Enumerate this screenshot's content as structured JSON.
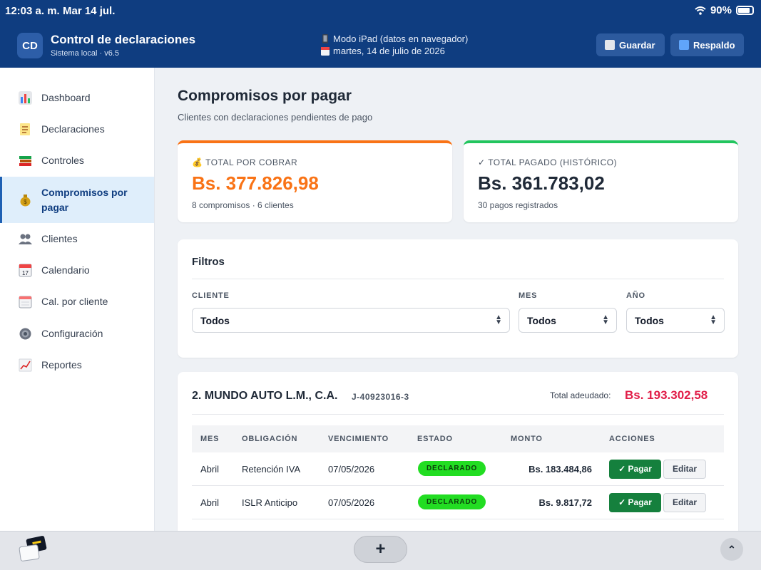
{
  "status_bar": {
    "time": "12:03 a. m.",
    "date": "Mar 14 jul.",
    "battery": "90%",
    "battery_level": 0.9
  },
  "header": {
    "logo": "CD",
    "title": "Control de declaraciones",
    "subtitle": "Sistema local · v6.5",
    "mode_text": "Modo iPad (datos en navegador)",
    "date_text": "martes, 14 de julio de 2026",
    "save_label": "Guardar",
    "backup_label": "Respaldo"
  },
  "sidebar": {
    "items": [
      {
        "label": "Dashboard",
        "icon": "bar-chart-icon"
      },
      {
        "label": "Declaraciones",
        "icon": "memo-icon"
      },
      {
        "label": "Controles",
        "icon": "books-icon"
      },
      {
        "label": "Compromisos por pagar",
        "icon": "money-bag-icon",
        "active": true
      },
      {
        "label": "Clientes",
        "icon": "users-icon"
      },
      {
        "label": "Calendario",
        "icon": "calendar-icon"
      },
      {
        "label": "Cal. por cliente",
        "icon": "spiral-calendar-icon"
      },
      {
        "label": "Configuración",
        "icon": "gear-icon"
      },
      {
        "label": "Reportes",
        "icon": "chart-up-icon"
      }
    ]
  },
  "main": {
    "title": "Compromisos por pagar",
    "subtitle": "Clientes con declaraciones pendientes de pago",
    "stats": {
      "cobrar": {
        "label": "TOTAL POR COBRAR",
        "value": "Bs. 377.826,98",
        "meta": "8 compromisos · 6 clientes",
        "color": "#f97316"
      },
      "pagado": {
        "label": "TOTAL PAGADO (HISTÓRICO)",
        "value": "Bs. 361.783,02",
        "meta": "30 pagos registrados",
        "color": "#22c55e"
      }
    },
    "filters": {
      "title": "Filtros",
      "cliente_label": "CLIENTE",
      "cliente_value": "Todos",
      "mes_label": "MES",
      "mes_value": "Todos",
      "anio_label": "AÑO",
      "anio_value": "Todos"
    },
    "client_card": {
      "name": "2. MUNDO AUTO L.M., C.A.",
      "rif": "J-40923016-3",
      "owed_label": "Total adeudado:",
      "owed_value": "Bs. 193.302,58",
      "columns": [
        "MES",
        "OBLIGACIÓN",
        "VENCIMIENTO",
        "ESTADO",
        "MONTO",
        "ACCIONES"
      ],
      "rows": [
        {
          "mes": "Abril",
          "obligacion": "Retención IVA",
          "vencimiento": "07/05/2026",
          "estado": "DECLARADO",
          "monto": "Bs. 183.484,86",
          "pay": "✓ Pagar",
          "edit": "Editar"
        },
        {
          "mes": "Abril",
          "obligacion": "ISLR Anticipo",
          "vencimiento": "07/05/2026",
          "estado": "DECLARADO",
          "monto": "Bs. 9.817,72",
          "pay": "✓ Pagar",
          "edit": "Editar"
        }
      ]
    }
  },
  "dock": {
    "plus": "+",
    "up": "^"
  }
}
